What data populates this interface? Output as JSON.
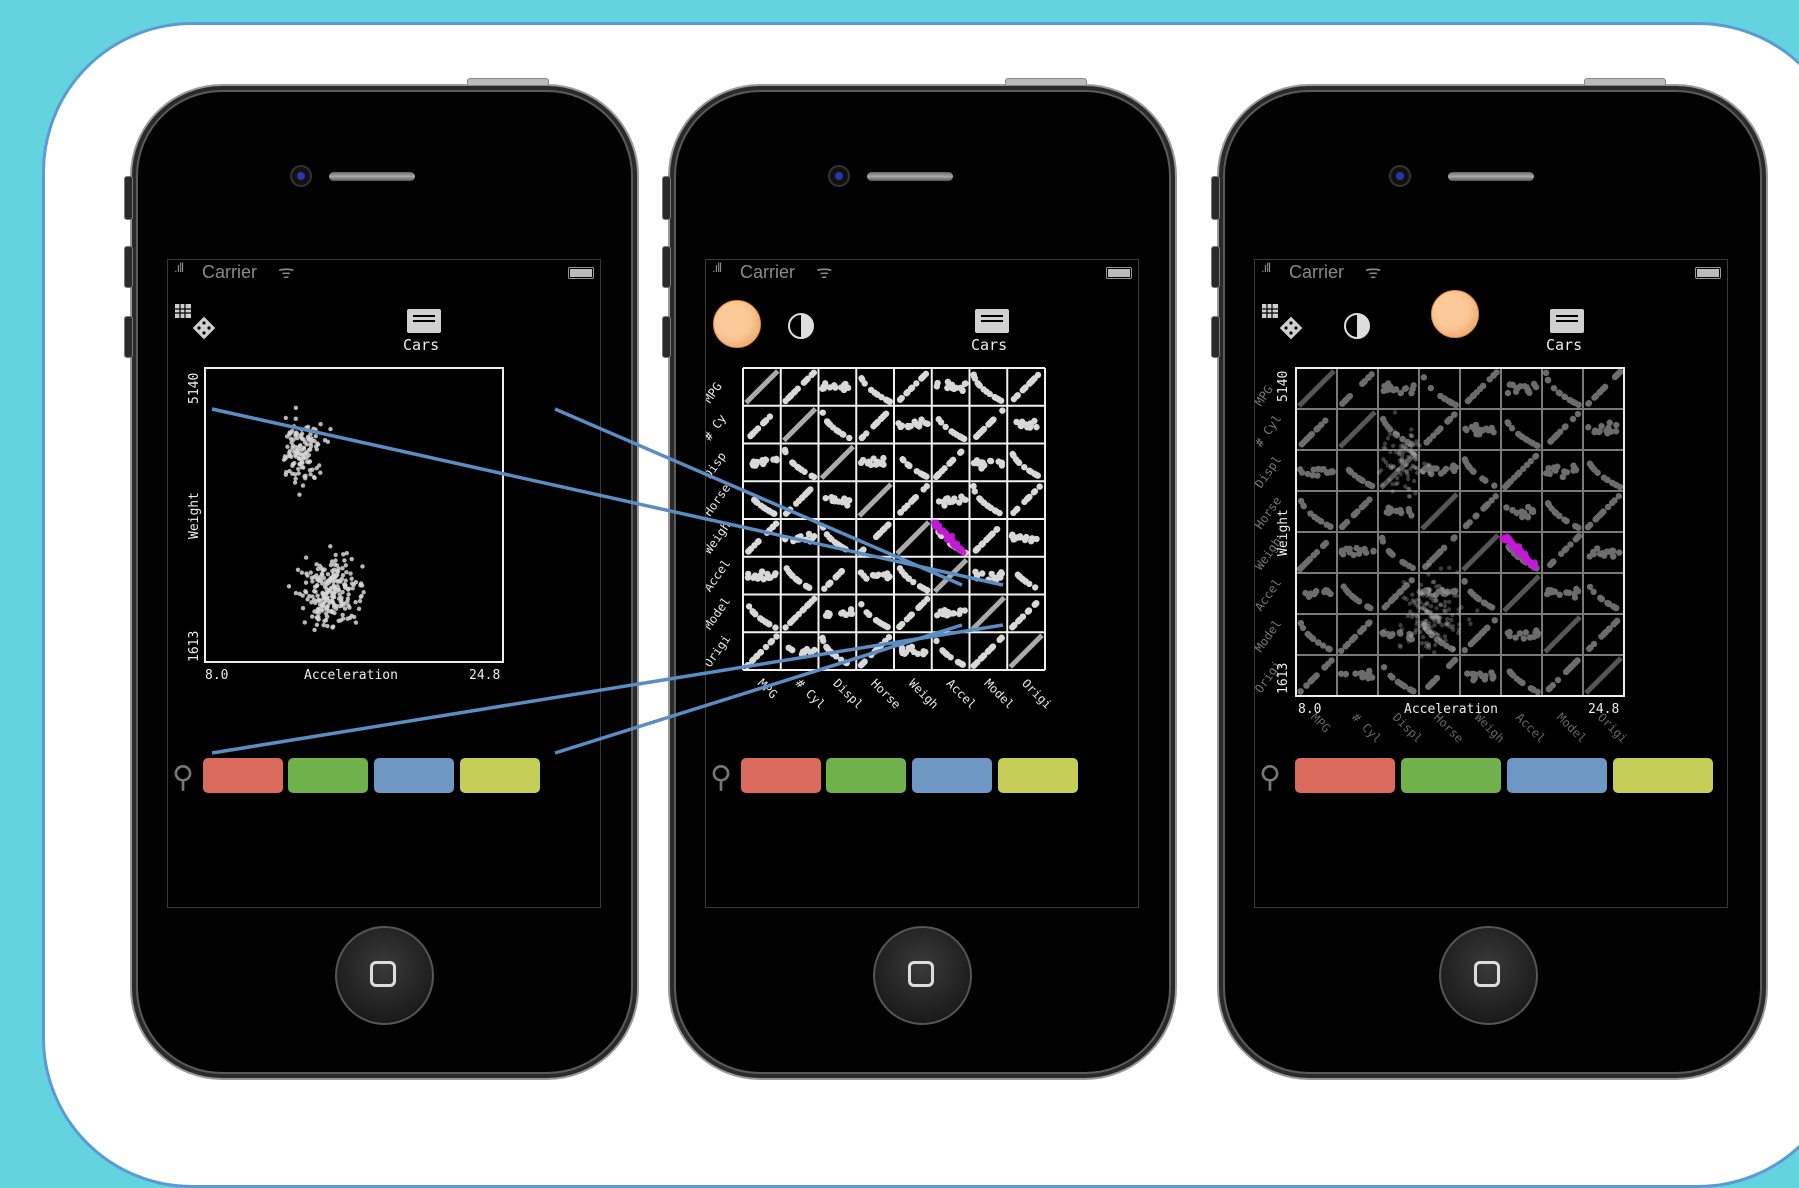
{
  "status_bar": {
    "signal": ".ıll",
    "carrier": "Carrier",
    "wifi": "ᯤ"
  },
  "dataset_title": "Cars",
  "icons": [
    "grid-dice-icon",
    "contrast-icon",
    "cars-sheet-icon",
    "search-icon",
    "home-button-icon"
  ],
  "color_buttons": [
    {
      "name": "red",
      "color": "#d96a5c"
    },
    {
      "name": "green",
      "color": "#6fb24c"
    },
    {
      "name": "blue",
      "color": "#6f97c3"
    },
    {
      "name": "yellow",
      "color": "#c4cd55"
    }
  ],
  "colors": {
    "background": "#63d3df",
    "card_border": "#5b9bd5",
    "highlight": "#c31bd6",
    "orange_dot": "#fcc999"
  },
  "chart_data": [
    {
      "type": "scatter",
      "title": "",
      "xlabel": "Acceleration",
      "ylabel": "Weight",
      "x_ticks": [
        "8.0",
        "24.8"
      ],
      "y_ticks": [
        "1613",
        "5140"
      ],
      "xlim": [
        8.0,
        24.8
      ],
      "ylim": [
        1613,
        5140
      ],
      "series": []
    },
    {
      "type": "scatter",
      "matrix_variables": [
        "MPG",
        "# Cyl",
        "Displ",
        "Horse",
        "Weigh",
        "Accel",
        "Model",
        "Origi"
      ],
      "left_labels": [
        "MPG",
        "# Cy",
        "Disp",
        "Horse",
        "Weigh",
        "Accel",
        "Model",
        "Origi"
      ],
      "bottom_labels": [
        "MPG",
        "# Cyl",
        "Displ",
        "Horse",
        "Weigh",
        "Accel",
        "Model",
        "Origi"
      ],
      "highlighted_cell": "Weigh × Accel"
    },
    {
      "type": "scatter",
      "xlabel": "Acceleration",
      "ylabel": "Weight",
      "x_ticks": [
        "8.0",
        "24.8"
      ],
      "y_ticks": [
        "1613",
        "5140"
      ],
      "overlay_left_labels": [
        "MPG",
        "# Cyl",
        "Displ",
        "Horse",
        "Weigh",
        "Accel",
        "Model",
        "Origi"
      ],
      "overlay_bottom_labels": [
        "MPG",
        "# Cyl",
        "Displ",
        "Horse",
        "Weigh",
        "Accel",
        "Model",
        "Origi"
      ]
    }
  ]
}
